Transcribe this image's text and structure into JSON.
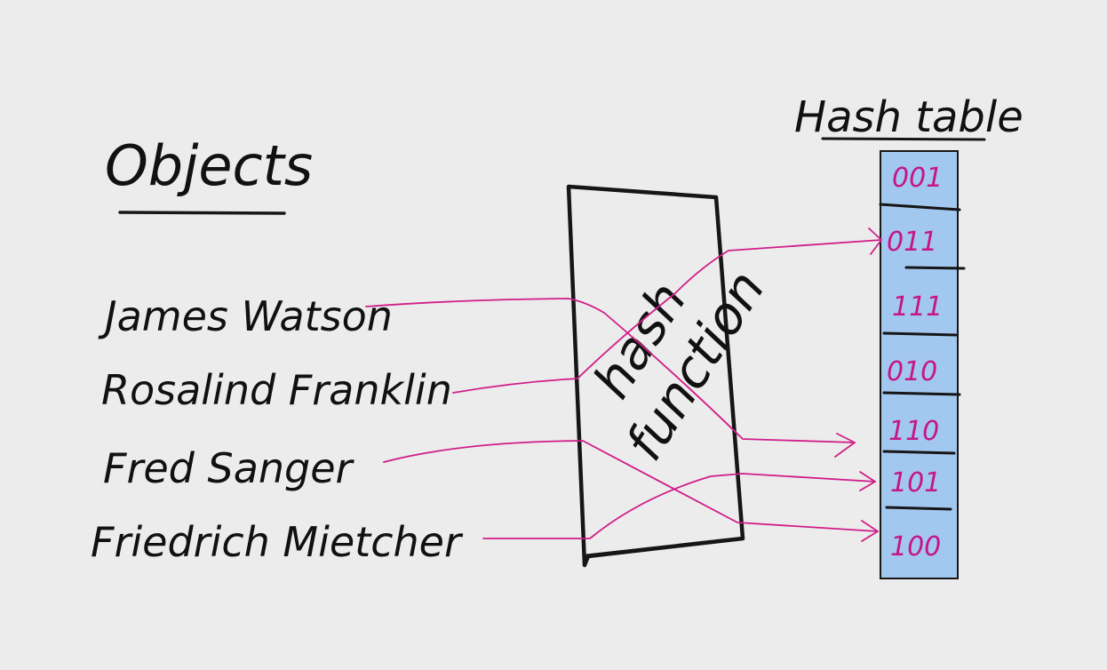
{
  "objects_heading": "Objects",
  "objects": [
    {
      "name": "James Watson"
    },
    {
      "name": "Rosalind Franklin"
    },
    {
      "name": "Fred Sanger"
    },
    {
      "name": "Friedrich Mietcher"
    }
  ],
  "hash_function": {
    "line1": "hash",
    "line2": "function"
  },
  "hash_table": {
    "title": "Hash table",
    "fill_color": "#a3c8ef",
    "slots": [
      "001",
      "011",
      "111",
      "010",
      "110",
      "101",
      "100"
    ]
  },
  "mapping": [
    {
      "from": "James Watson",
      "to": "110"
    },
    {
      "from": "Rosalind Franklin",
      "to": "011"
    },
    {
      "from": "Fred Sanger",
      "to": "100"
    },
    {
      "from": "Friedrich Mietcher",
      "to": "101"
    }
  ],
  "colors": {
    "ink": "#161616",
    "arrow": "#d01e88",
    "slot_text": "#c4168a",
    "background": "#ececec"
  }
}
